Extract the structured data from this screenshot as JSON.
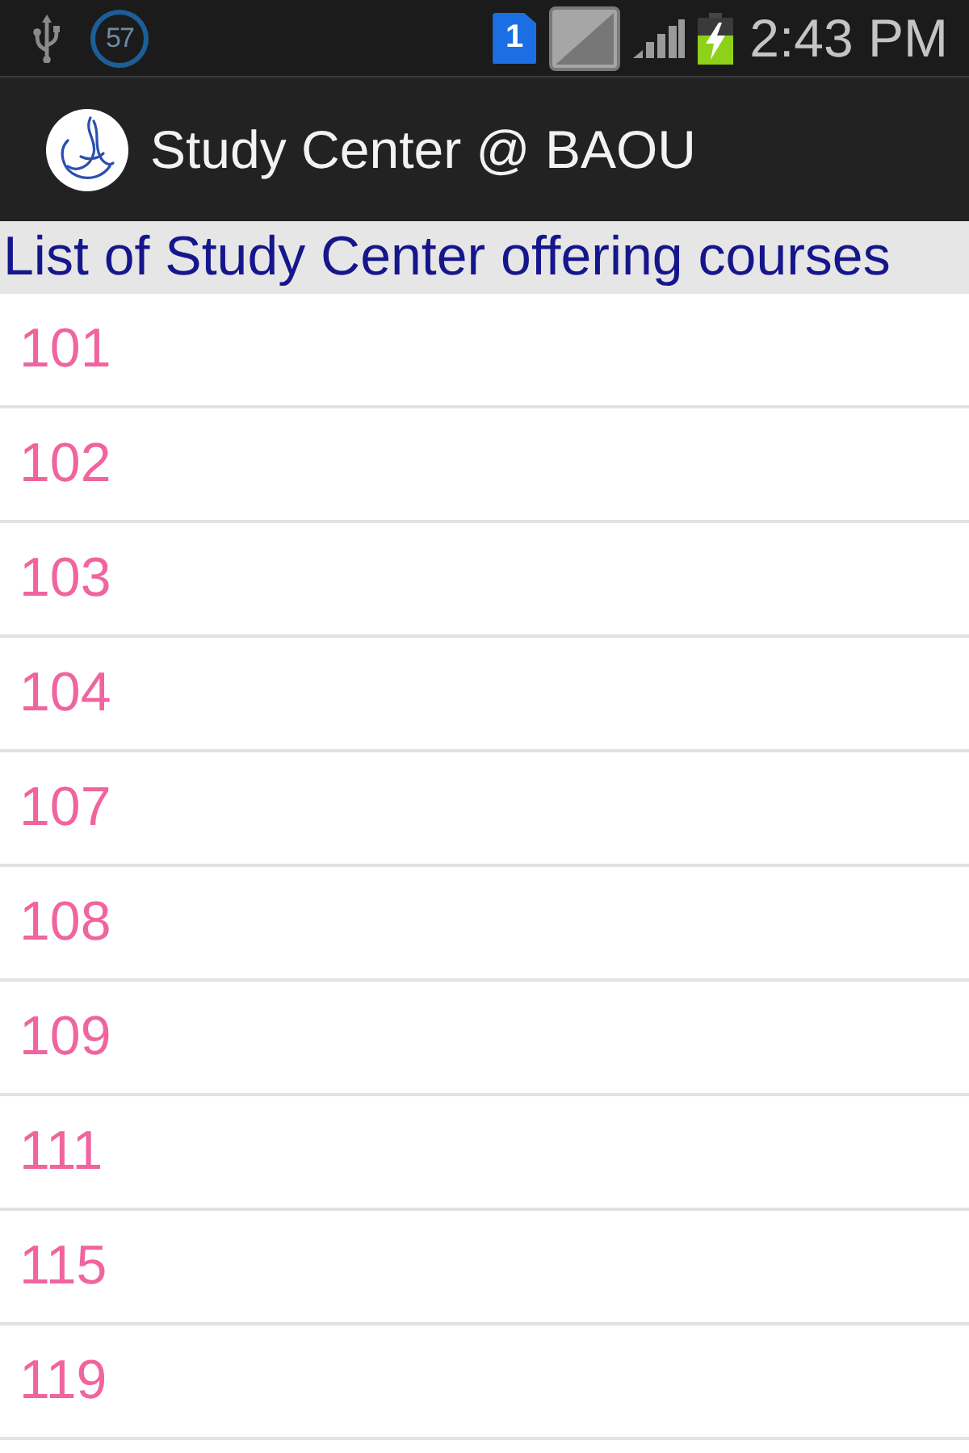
{
  "status_bar": {
    "notification_count": "57",
    "sim_slot": "1",
    "time": "2:43 PM"
  },
  "app_bar": {
    "title": "Study Center @ BAOU"
  },
  "list_header": "List of Study Center offering courses",
  "items": [
    {
      "label": "101"
    },
    {
      "label": "102"
    },
    {
      "label": "103"
    },
    {
      "label": "104"
    },
    {
      "label": "107"
    },
    {
      "label": "108"
    },
    {
      "label": "109"
    },
    {
      "label": "111"
    },
    {
      "label": "115"
    },
    {
      "label": "119"
    }
  ]
}
